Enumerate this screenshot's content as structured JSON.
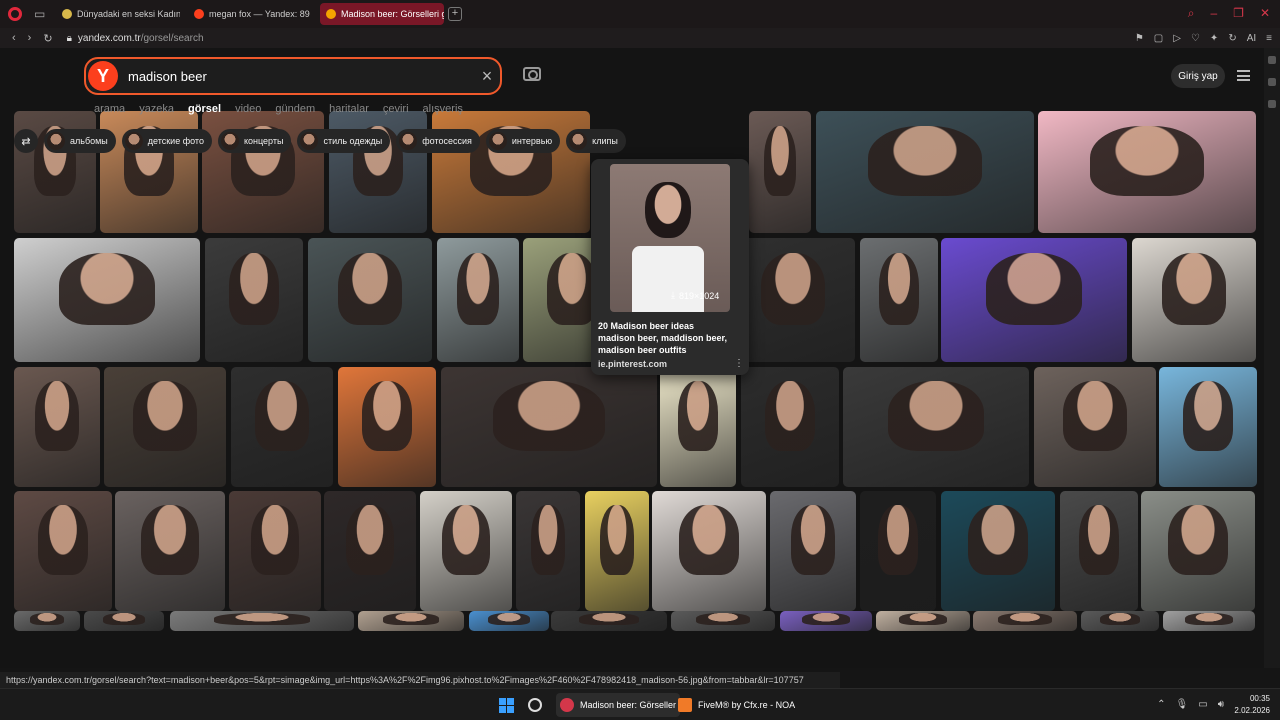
{
  "browser": {
    "tabs": [
      {
        "label": "Dünyadaki en seksi Kadın",
        "favicon_color": "#d8b84a",
        "active": false
      },
      {
        "label": "megan fox — Yandex: 89",
        "favicon_color": "#fc3f1d",
        "active": false
      },
      {
        "label": "Madison beer: Görselleri g",
        "favicon_color": "#f5a400",
        "active": true
      }
    ],
    "url_host": "yandex.com.tr",
    "url_path": "/gorsel/search",
    "ext_ai_label": "AI"
  },
  "search": {
    "logo": "Y",
    "query": "madison beer",
    "clear": "×"
  },
  "header": {
    "login_label": "Giriş yap"
  },
  "nav_tabs": [
    {
      "label": "arama",
      "active": false
    },
    {
      "label": "yazeka",
      "active": false
    },
    {
      "label": "görsel",
      "active": true
    },
    {
      "label": "video",
      "active": false
    },
    {
      "label": "gündem",
      "active": false
    },
    {
      "label": "haritalar",
      "active": false
    },
    {
      "label": "çeviri",
      "active": false
    },
    {
      "label": "alışveriş",
      "active": false
    }
  ],
  "chips": [
    "альбомы",
    "детские фото",
    "концерты",
    "стиль одежды",
    "фотосессия",
    "интервью",
    "клипы"
  ],
  "preview": {
    "resolution": "819×1024",
    "title": "20 Madison beer ideas madison beer, maddison beer, madison beer outfits",
    "source": "ie.pinterest.com",
    "more": "⋮"
  },
  "status_url": "https://yandex.com.tr/gorsel/search?text=madison+beer&pos=5&rpt=simage&img_url=https%3A%2F%2Fimg96.pixhost.to%2Fimages%2F460%2F478982418_madison-56.jpg&from=tabbar&lr=107757",
  "taskbar": {
    "apps": [
      {
        "label": "Madison beer: Görseller",
        "icon_color": "#d4374a"
      },
      {
        "label": "FiveM® by Cfx.re - NOA",
        "icon_color": "#f07a28"
      }
    ],
    "time": "00:35",
    "date": "2.02.2026"
  }
}
